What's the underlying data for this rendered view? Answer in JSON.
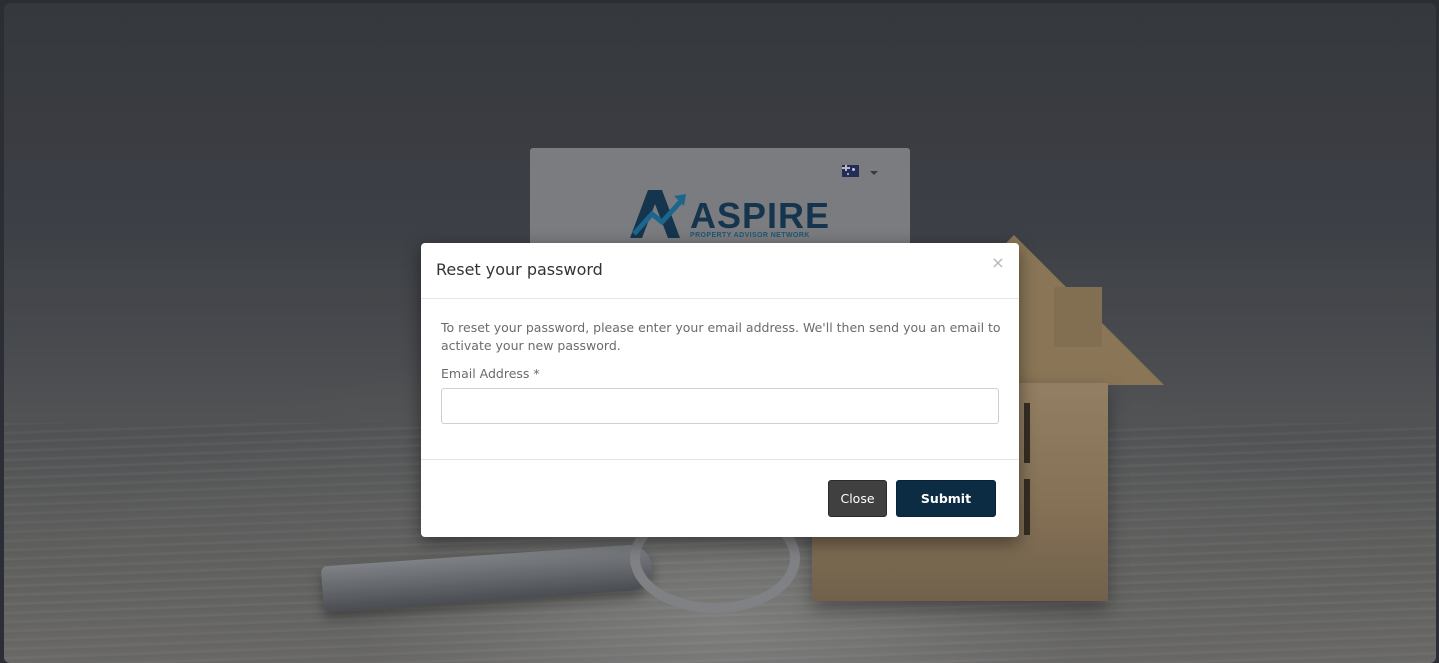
{
  "background": {
    "frame_color": "#2b2f35"
  },
  "login_card": {
    "language_flag": "au-flag-icon",
    "logo_word": "ASPIRE",
    "logo_tagline": "PROPERTY ADVISOR NETWORK",
    "brand_color": "#173a55"
  },
  "modal": {
    "title": "Reset your password",
    "close_icon": "×",
    "intro_text": "To reset your password, please enter your email address. We'll then send you an email to activate your new password.",
    "email_label": "Email Address *",
    "email_value": "",
    "email_placeholder": "",
    "close_label": "Close",
    "submit_label": "Submit",
    "close_button_color": "#404040",
    "submit_button_color": "#0c2c44"
  }
}
